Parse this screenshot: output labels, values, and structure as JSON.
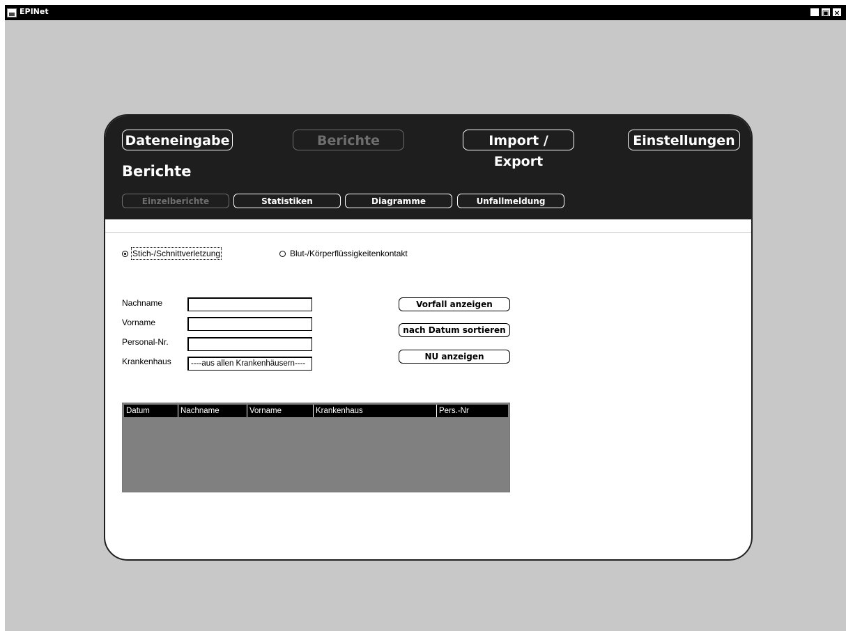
{
  "window": {
    "title": "EPINet",
    "controls": {
      "minimize": "_",
      "restore": "▣",
      "close": "×"
    }
  },
  "nav": {
    "main_tabs": [
      {
        "label": "Dateneingabe",
        "active": false
      },
      {
        "label": "Berichte",
        "active": true
      },
      {
        "label": "Import / Export",
        "active": false
      },
      {
        "label": "Einstellungen",
        "active": false
      }
    ],
    "section_title": "Berichte",
    "sub_tabs": [
      {
        "label": "Einzelberichte",
        "active": true
      },
      {
        "label": "Statistiken",
        "active": false
      },
      {
        "label": "Diagramme",
        "active": false
      },
      {
        "label": "Unfallmeldung",
        "active": false
      }
    ]
  },
  "report_type": {
    "options": [
      {
        "label": "Stich-/Schnittverletzung",
        "checked": true
      },
      {
        "label": "Blut-/Körperflüssigkeitenkontakt",
        "checked": false
      }
    ]
  },
  "form": {
    "nachname_label": "Nachname",
    "nachname_value": "",
    "vorname_label": "Vorname",
    "vorname_value": "",
    "personal_label": "Personal-Nr.",
    "personal_value": "",
    "krankenhaus_label": "Krankenhaus",
    "krankenhaus_value": "----aus allen Krankenhäusern----"
  },
  "actions": {
    "show_incident": "Vorfall anzeigen",
    "sort_by_date": "nach Datum sortieren",
    "show_nu": "NU anzeigen"
  },
  "table": {
    "columns": [
      "Datum",
      "Nachname",
      "Vorname",
      "Krankenhaus",
      "Pers.-Nr"
    ],
    "rows": []
  },
  "colors": {
    "header_bg": "#1e1e1e",
    "window_bg": "#c8c8c8",
    "table_bg": "#808080",
    "disabled_text": "#6e6e6e"
  }
}
